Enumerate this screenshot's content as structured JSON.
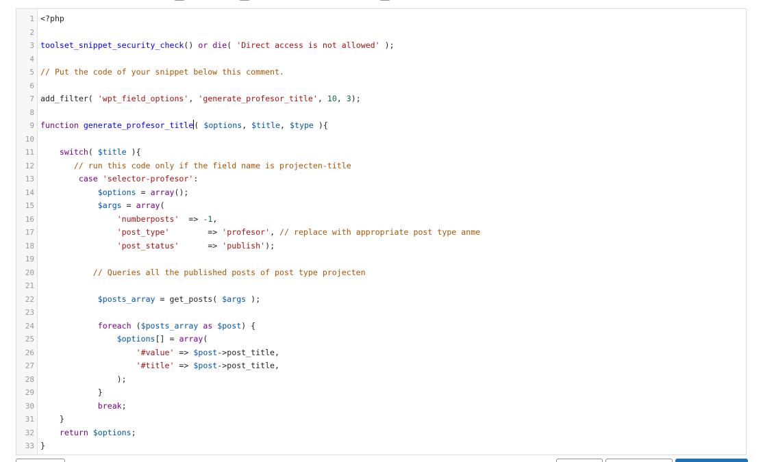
{
  "editor": {
    "lines": [
      {
        "n": "1",
        "tokens": [
          [
            "op",
            "<?php"
          ]
        ]
      },
      {
        "n": "2",
        "tokens": []
      },
      {
        "n": "3",
        "tokens": [
          [
            "def",
            "toolset_snippet_security_check"
          ],
          [
            "op",
            "() "
          ],
          [
            "kw",
            "or"
          ],
          [
            "op",
            " "
          ],
          [
            "kw",
            "die"
          ],
          [
            "op",
            "( "
          ],
          [
            "str",
            "'Direct access is not allowed'"
          ],
          [
            "op",
            " );"
          ]
        ]
      },
      {
        "n": "4",
        "tokens": []
      },
      {
        "n": "5",
        "tokens": [
          [
            "com",
            "// Put the code of your snippet below this comment."
          ]
        ]
      },
      {
        "n": "6",
        "tokens": []
      },
      {
        "n": "7",
        "tokens": [
          [
            "op",
            "add_filter( "
          ],
          [
            "str",
            "'wpt_field_options'"
          ],
          [
            "op",
            ", "
          ],
          [
            "str",
            "'generate_profesor_title'"
          ],
          [
            "op",
            ", "
          ],
          [
            "num",
            "10"
          ],
          [
            "op",
            ", "
          ],
          [
            "num",
            "3"
          ],
          [
            "op",
            ");"
          ]
        ]
      },
      {
        "n": "8",
        "tokens": []
      },
      {
        "n": "9",
        "tokens": [
          [
            "kw",
            "function"
          ],
          [
            "op",
            " "
          ],
          [
            "def",
            "generate_profesor_title"
          ],
          [
            "cursor",
            ""
          ],
          [
            "op",
            "( "
          ],
          [
            "var",
            "$options"
          ],
          [
            "op",
            ", "
          ],
          [
            "var",
            "$title"
          ],
          [
            "op",
            ", "
          ],
          [
            "var",
            "$type"
          ],
          [
            "op",
            " ){"
          ]
        ]
      },
      {
        "n": "10",
        "tokens": []
      },
      {
        "n": "11",
        "tokens": [
          [
            "kw",
            "    switch"
          ],
          [
            "op",
            "( "
          ],
          [
            "var",
            "$title"
          ],
          [
            "op",
            " ){"
          ]
        ]
      },
      {
        "n": "12",
        "tokens": [
          [
            "com",
            "       // run this code only if the field name is projecten-title"
          ]
        ]
      },
      {
        "n": "13",
        "tokens": [
          [
            "kw",
            "        case"
          ],
          [
            "op",
            " "
          ],
          [
            "str",
            "'selector-profesor'"
          ],
          [
            "op",
            ":"
          ]
        ]
      },
      {
        "n": "14",
        "tokens": [
          [
            "op",
            "            "
          ],
          [
            "var",
            "$options"
          ],
          [
            "op",
            " = "
          ],
          [
            "kw",
            "array"
          ],
          [
            "op",
            "();"
          ]
        ]
      },
      {
        "n": "15",
        "tokens": [
          [
            "op",
            "            "
          ],
          [
            "var",
            "$args"
          ],
          [
            "op",
            " = "
          ],
          [
            "kw",
            "array"
          ],
          [
            "op",
            "("
          ]
        ]
      },
      {
        "n": "16",
        "tokens": [
          [
            "op",
            "                "
          ],
          [
            "str",
            "'numberposts'"
          ],
          [
            "op",
            "  => "
          ],
          [
            "num",
            "-1"
          ],
          [
            "op",
            ","
          ]
        ]
      },
      {
        "n": "17",
        "tokens": [
          [
            "op",
            "                "
          ],
          [
            "str",
            "'post_type'"
          ],
          [
            "op",
            "        => "
          ],
          [
            "str",
            "'profesor'"
          ],
          [
            "op",
            ", "
          ],
          [
            "com",
            "// replace with appropriate post type anme"
          ]
        ]
      },
      {
        "n": "18",
        "tokens": [
          [
            "op",
            "                "
          ],
          [
            "str",
            "'post_status'"
          ],
          [
            "op",
            "      => "
          ],
          [
            "str",
            "'publish'"
          ],
          [
            "op",
            ");"
          ]
        ]
      },
      {
        "n": "19",
        "tokens": []
      },
      {
        "n": "20",
        "tokens": [
          [
            "com",
            "           // Queries all the published posts of post type projecten"
          ]
        ]
      },
      {
        "n": "21",
        "tokens": []
      },
      {
        "n": "22",
        "tokens": [
          [
            "op",
            "            "
          ],
          [
            "var",
            "$posts_array"
          ],
          [
            "op",
            " = get_posts( "
          ],
          [
            "var",
            "$args"
          ],
          [
            "op",
            " );"
          ]
        ]
      },
      {
        "n": "23",
        "tokens": []
      },
      {
        "n": "24",
        "tokens": [
          [
            "kw",
            "            foreach"
          ],
          [
            "op",
            " ("
          ],
          [
            "var",
            "$posts_array"
          ],
          [
            "op",
            " "
          ],
          [
            "kw",
            "as"
          ],
          [
            "op",
            " "
          ],
          [
            "var",
            "$post"
          ],
          [
            "op",
            ") {"
          ]
        ]
      },
      {
        "n": "25",
        "tokens": [
          [
            "op",
            "                "
          ],
          [
            "var",
            "$options"
          ],
          [
            "op",
            "[] = "
          ],
          [
            "kw",
            "array"
          ],
          [
            "op",
            "("
          ]
        ]
      },
      {
        "n": "26",
        "tokens": [
          [
            "op",
            "                    "
          ],
          [
            "str",
            "'#value'"
          ],
          [
            "op",
            " => "
          ],
          [
            "var",
            "$post"
          ],
          [
            "op",
            "->post_title,"
          ]
        ]
      },
      {
        "n": "27",
        "tokens": [
          [
            "op",
            "                    "
          ],
          [
            "str",
            "'#title'"
          ],
          [
            "op",
            " => "
          ],
          [
            "var",
            "$post"
          ],
          [
            "op",
            "->post_title,"
          ]
        ]
      },
      {
        "n": "28",
        "tokens": [
          [
            "op",
            "                );"
          ]
        ]
      },
      {
        "n": "29",
        "tokens": [
          [
            "op",
            "            }"
          ]
        ]
      },
      {
        "n": "30",
        "tokens": [
          [
            "kw",
            "            break"
          ],
          [
            "op",
            ";"
          ]
        ]
      },
      {
        "n": "31",
        "tokens": [
          [
            "op",
            "    }"
          ]
        ]
      },
      {
        "n": "32",
        "tokens": [
          [
            "kw",
            "    return"
          ],
          [
            "op",
            " "
          ],
          [
            "var",
            "$options"
          ],
          [
            "op",
            ";"
          ]
        ]
      },
      {
        "n": "33",
        "tokens": [
          [
            "op",
            "}"
          ]
        ]
      }
    ]
  }
}
